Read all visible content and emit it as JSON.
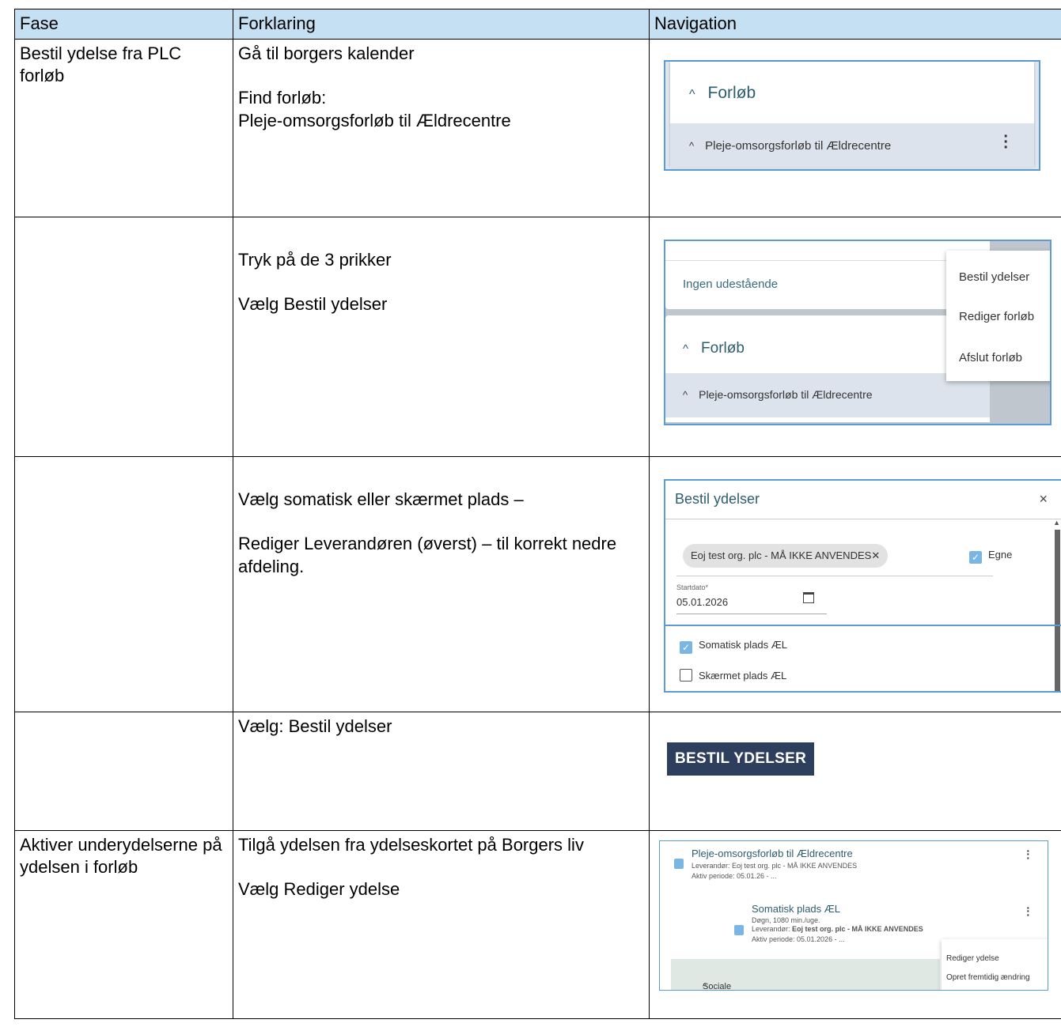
{
  "headers": [
    "Fase",
    "Forklaring",
    "Navigation"
  ],
  "rows": [
    {
      "phase": "Bestil ydelse fra PLC forløb",
      "explanation": [
        "Gå til borgers kalender",
        "Find forløb:",
        "Pleje-omsorgsforløb til Ældrecentre"
      ],
      "nav": {
        "heading": "Forløb",
        "course": "Pleje-omsorgsforløb til Ældrecentre"
      }
    },
    {
      "phase": "",
      "explanation": [
        "Tryk på de 3 prikker",
        "Vælg Bestil ydelser"
      ],
      "nav": {
        "top_label": "Ingen udestående",
        "heading": "Forløb",
        "course": "Pleje-omsorgsforløb til Ældrecentre",
        "menu": [
          "Bestil ydelser",
          "Rediger forløb",
          "Afslut forløb"
        ]
      }
    },
    {
      "phase": "",
      "explanation": [
        "Vælg somatisk eller skærmet plads –",
        "Rediger Leverandøren (øverst) – til korrekt nedre afdeling."
      ],
      "nav": {
        "title": "Bestil ydelser",
        "close": "×",
        "chip": "Eoj test org. plc - MÅ IKKE ANVENDES",
        "chip_remove": "✕",
        "own_label": "Egne",
        "start_label": "Startdato*",
        "start_value": "05.01.2026",
        "options": [
          {
            "label": "Somatisk plads ÆL",
            "checked": true
          },
          {
            "label": "Skærmet plads ÆL",
            "checked": false
          }
        ]
      }
    },
    {
      "phase": "",
      "explanation": [
        "Vælg: Bestil ydelser"
      ],
      "nav": {
        "button": "BESTIL YDELSER"
      }
    },
    {
      "phase": "Aktiver underydelserne på ydelsen i forløb",
      "explanation": [
        "Tilgå ydelsen fra ydelseskortet på Borgers liv",
        "Vælg Rediger ydelse"
      ],
      "nav": {
        "course": "Pleje-omsorgsforløb til Ældrecentre",
        "course_supplier": "Leverandør: Eoj test org. plc - MÅ IKKE ANVENDES",
        "course_period": "Aktiv periode: 05.01.26 - ...",
        "service": "Somatisk plads ÆL",
        "service_meta": "Døgn, 1080 min./uge.",
        "service_supplier_label": "Leverandør:",
        "service_supplier": "Eoj test org. plc - MÅ IKKE ANVENDES",
        "service_period": "Aktiv periode: 05.01.2026 - ...",
        "social": "Sociale sagstyper",
        "menu": [
          "Rediger ydelse",
          "Opret fremtidig ændring"
        ]
      }
    }
  ],
  "colors": {
    "header_bg": "#c5e0f2",
    "accent": "#5b9bd5",
    "button_bg": "#2e3f5e"
  }
}
